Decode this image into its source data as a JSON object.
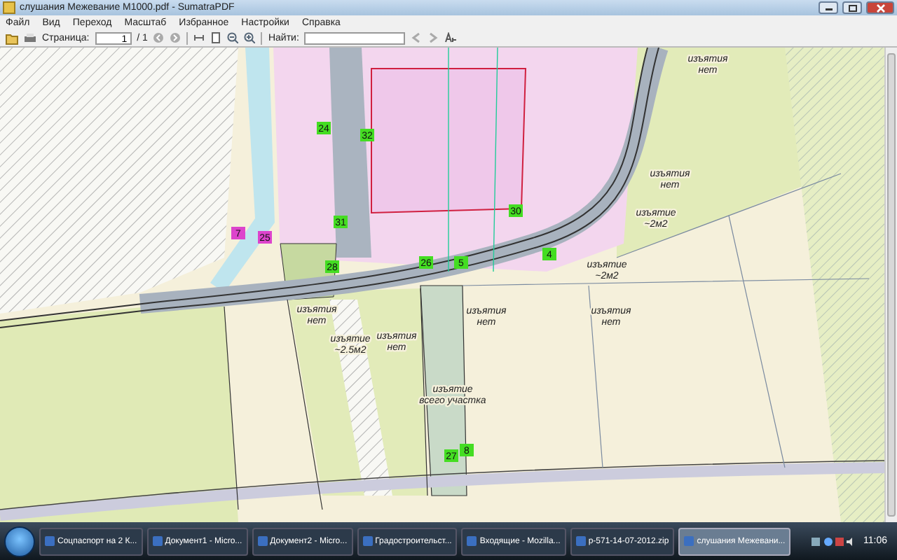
{
  "window": {
    "title": "слушания Межевание М1000.pdf - SumatraPDF"
  },
  "menu": [
    "Файл",
    "Вид",
    "Переход",
    "Масштаб",
    "Избранное",
    "Настройки",
    "Справка"
  ],
  "toolbar": {
    "page_label": "Страница:",
    "page_value": "1",
    "page_total": "/ 1",
    "find_label": "Найти:"
  },
  "map": {
    "labels": [
      {
        "lines": [
          "изъятия",
          "нет"
        ]
      },
      {
        "lines": [
          "изъятия",
          "нет"
        ]
      },
      {
        "lines": [
          "изъятие",
          "~2м2"
        ]
      },
      {
        "lines": [
          "изъятие",
          "~2м2"
        ]
      },
      {
        "lines": [
          "изъятия",
          "нет"
        ]
      },
      {
        "lines": [
          "изъятия",
          "нет"
        ]
      },
      {
        "lines": [
          "изъятия",
          "нет"
        ]
      },
      {
        "lines": [
          "изъятие",
          "~2.5м2"
        ]
      },
      {
        "lines": [
          "изъятия",
          "нет"
        ]
      },
      {
        "lines": [
          "изъятие",
          "всего участка"
        ]
      }
    ],
    "markers": [
      {
        "text": "24",
        "color": "#44dd22"
      },
      {
        "text": "32",
        "color": "#44dd22"
      },
      {
        "text": "31",
        "color": "#44dd22"
      },
      {
        "text": "30",
        "color": "#44dd22"
      },
      {
        "text": "28",
        "color": "#44dd22"
      },
      {
        "text": "26",
        "color": "#44dd22"
      },
      {
        "text": "5",
        "color": "#44dd22"
      },
      {
        "text": "4",
        "color": "#44dd22"
      },
      {
        "text": "27",
        "color": "#44dd22"
      },
      {
        "text": "8",
        "color": "#44dd22"
      },
      {
        "text": "7",
        "color": "#dd44cc"
      },
      {
        "text": "25",
        "color": "#dd44cc"
      }
    ]
  },
  "taskbar": {
    "items": [
      {
        "label": "Соцпаспорт на 2 К...",
        "selected": false
      },
      {
        "label": "Документ1 - Micro...",
        "selected": false
      },
      {
        "label": "Документ2 - Micro...",
        "selected": false
      },
      {
        "label": "Градостроительст...",
        "selected": false
      },
      {
        "label": "Входящие - Mozilla...",
        "selected": false
      },
      {
        "label": "p-571-14-07-2012.zip",
        "selected": false
      },
      {
        "label": "слушания Межевани...",
        "selected": true
      }
    ],
    "clock": "11:06"
  }
}
